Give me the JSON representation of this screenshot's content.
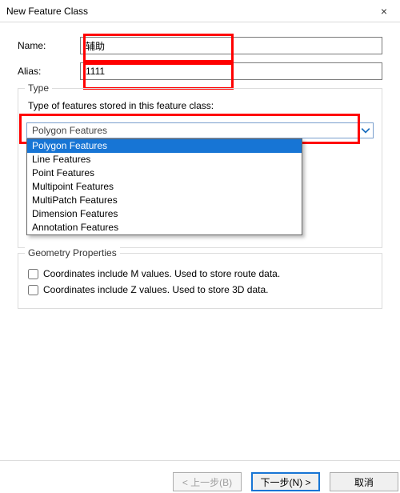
{
  "window": {
    "title": "New Feature Class",
    "close_label": "×"
  },
  "fields": {
    "name_label": "Name:",
    "name_value": "辅助",
    "alias_label": "Alias:",
    "alias_value": "1111"
  },
  "type_group": {
    "legend": "Type",
    "description": "Type of features stored in this feature class:",
    "selected": "Polygon Features",
    "options": [
      "Polygon Features",
      "Line Features",
      "Point Features",
      "Multipoint Features",
      "MultiPatch Features",
      "Dimension Features",
      "Annotation Features"
    ],
    "highlight_index": 0
  },
  "geometry_group": {
    "legend": "Geometry Properties",
    "m_label": "Coordinates include M values. Used to store route data.",
    "z_label": "Coordinates include Z values. Used to store 3D data."
  },
  "buttons": {
    "back": "< 上一步(B)",
    "next": "下一步(N) >",
    "cancel": "取消"
  },
  "colors": {
    "highlight": "#1775d5",
    "red_frame": "#ff0000"
  }
}
